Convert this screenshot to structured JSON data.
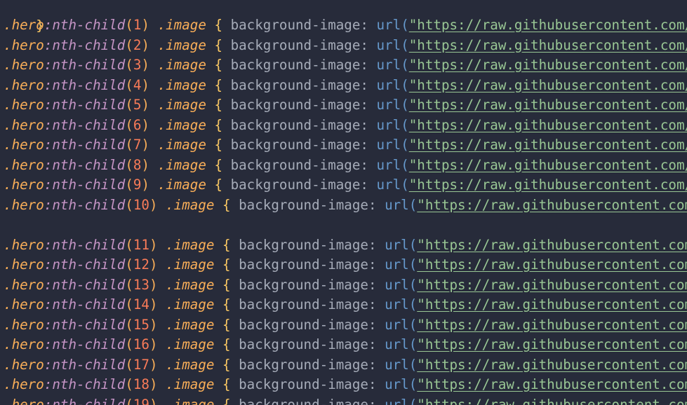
{
  "theme": {
    "background": "#272b3a",
    "selector": "#f9ae58",
    "pseudo": "#c594c5",
    "number": "#f97b58",
    "brace": "#fac863",
    "property": "#a6acb9",
    "function": "#6699cc",
    "string": "#99c794"
  },
  "code": {
    "closing_brace": "}",
    "selector_class": "hero",
    "pseudo_name": "nth-child",
    "child_class": "image",
    "property": "background-image",
    "function": "url",
    "url_text": "https://raw.githubusercontent.com/",
    "lines": [
      {
        "n": "1"
      },
      {
        "n": "2"
      },
      {
        "n": "3"
      },
      {
        "n": "4"
      },
      {
        "n": "5"
      },
      {
        "n": "6"
      },
      {
        "n": "7"
      },
      {
        "n": "8"
      },
      {
        "n": "9"
      },
      {
        "n": "10"
      },
      {
        "n": ""
      },
      {
        "n": "11"
      },
      {
        "n": "12"
      },
      {
        "n": "13"
      },
      {
        "n": "14"
      },
      {
        "n": "15"
      },
      {
        "n": "16"
      },
      {
        "n": "17"
      },
      {
        "n": "18"
      },
      {
        "n": "19"
      }
    ]
  }
}
